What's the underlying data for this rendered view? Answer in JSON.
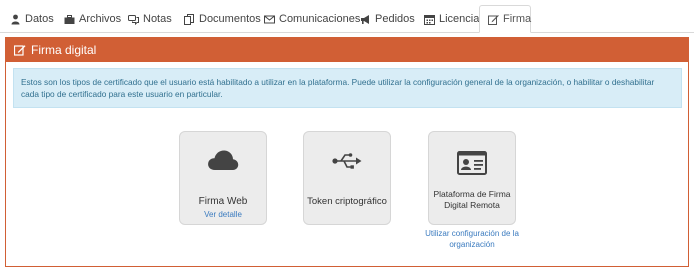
{
  "tabs": [
    {
      "label": "Datos",
      "icon": "user-icon"
    },
    {
      "label": "Archivos",
      "icon": "briefcase-icon"
    },
    {
      "label": "Notas",
      "icon": "comments-icon"
    },
    {
      "label": "Documentos",
      "icon": "files-icon"
    },
    {
      "label": "Comunicaciones",
      "icon": "envelope-icon"
    },
    {
      "label": "Pedidos",
      "icon": "bullhorn-icon"
    },
    {
      "label": "Licencias",
      "icon": "calendar-icon"
    },
    {
      "label": "Firma",
      "icon": "edit-icon",
      "active": true
    }
  ],
  "panel": {
    "title": "Firma digital",
    "header_color": "#d15f35",
    "info": "Estos son los tipos de certificado que el usuario está habilitado a utilizar en la plataforma. Puede utilizar la configuración general de la organización, o habilitar o deshabilitar cada tipo de certificado para este usuario en particular."
  },
  "cards": [
    {
      "title": "Firma Web",
      "link": "Ver detalle",
      "icon": "cloud-icon"
    },
    {
      "title": "Token criptográfico",
      "icon": "usb-icon"
    },
    {
      "title": "Plataforma de Firma Digital Remota",
      "icon": "id-card-icon",
      "below_link": "Utilizar configuración de la organización"
    }
  ]
}
